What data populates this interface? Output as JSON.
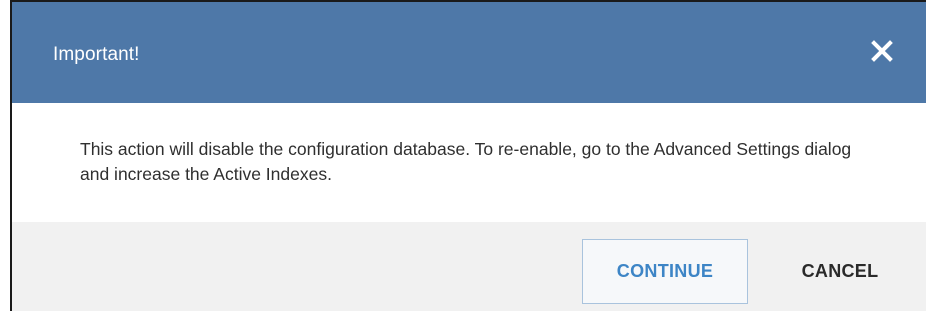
{
  "dialog": {
    "title": "Important!",
    "close_icon": "close-icon",
    "message": "This action will disable the configuration database. To re-enable, go to the Advanced Settings dialog and increase the Active Indexes.",
    "buttons": {
      "continue_label": "CONTINUE",
      "cancel_label": "CANCEL"
    }
  },
  "colors": {
    "header_background": "#4e78a8",
    "header_text": "#ffffff",
    "primary_button_text": "#3d85c6",
    "footer_background": "#f1f1f1"
  }
}
